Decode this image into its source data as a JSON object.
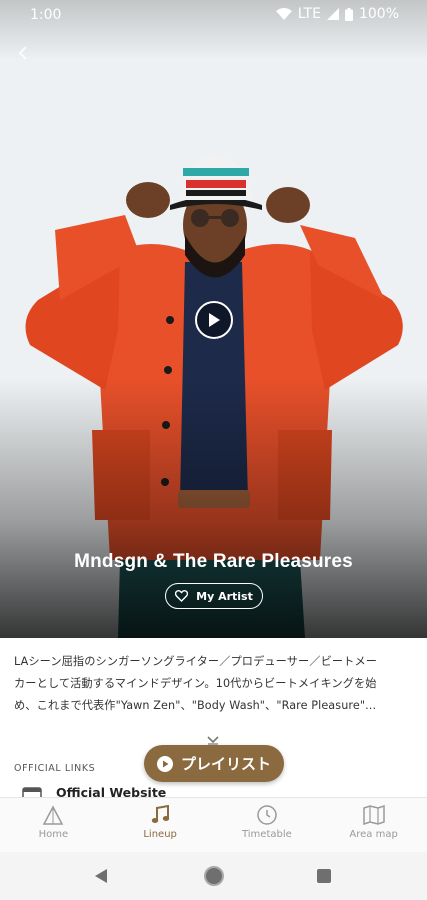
{
  "status_bar": {
    "time": "1:00",
    "network": "LTE",
    "battery": "100%"
  },
  "hero": {
    "artist_name": "Mndsgn & The Rare Pleasures",
    "my_artist_label": "My Artist",
    "back_icon": "chevron-left-icon",
    "play_icon": "play-icon"
  },
  "description": {
    "lines": [
      "LAシーン屈指のシンガーソングライター／プロデューサー／ビートメー",
      "カーとして活動するマインドデザイン。10代からビートメイキングを始",
      "め、これまで代表作\"Yawn Zen\"、\"Body Wash\"、\"Rare Pleasure\"…"
    ]
  },
  "official_links": {
    "heading": "OFFICIAL LINKS",
    "items": [
      {
        "label": "Official Website",
        "icon": "browser-icon"
      }
    ]
  },
  "playlist_button": {
    "label": "プレイリスト",
    "icon": "play-circle-icon"
  },
  "bottom_nav": {
    "items": [
      {
        "label": "Home",
        "icon": "home-icon",
        "active": false
      },
      {
        "label": "Lineup",
        "icon": "music-note-icon",
        "active": true
      },
      {
        "label": "Timetable",
        "icon": "clock-icon",
        "active": false
      },
      {
        "label": "Area map",
        "icon": "map-icon",
        "active": false
      }
    ]
  },
  "colors": {
    "accent": "#8a6a3e",
    "jacket": "#e8502a",
    "nav_inactive": "#9a9a9a"
  }
}
